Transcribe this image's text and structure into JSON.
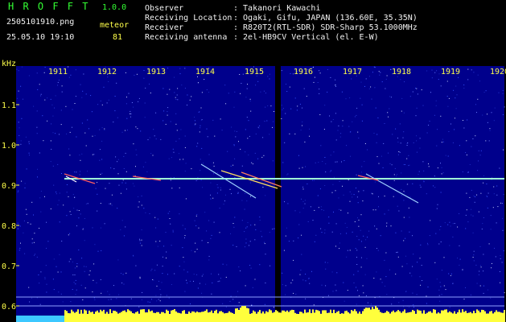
{
  "header": {
    "app_name": "H R O F F T",
    "version": "1.0.0",
    "filename": "2505101910.png",
    "timestamp": "25.05.10 19:10",
    "event_label": "meteor",
    "event_count": "81",
    "info_labels": [
      "Observer",
      "Receiving Location",
      "Receiver",
      "Receiving antenna"
    ],
    "info_values": [
      ": Takanori Kawachi",
      ": Ogaki, Gifu, JAPAN (136.60E, 35.35N)",
      ": R820T2(RTL-SDR) SDR-Sharp 53.1000MHz",
      ": 2el-HB9CV Vertical (el. E-W)"
    ]
  },
  "spectrogram": {
    "y_unit": "kHz",
    "y_ticks": [
      "1.1",
      "1.0",
      "0.9",
      "0.8",
      "0.7",
      "0.6"
    ],
    "x_ticks": [
      "1911",
      "1912",
      "1913",
      "1914",
      "1915",
      "1916",
      "1917",
      "1918",
      "1919",
      "1920"
    ],
    "colors": {
      "background": "#00008c",
      "carrier": "#9fffd8",
      "noise_bar": "#ffff3c",
      "axis_text": "#ffff4a"
    }
  }
}
